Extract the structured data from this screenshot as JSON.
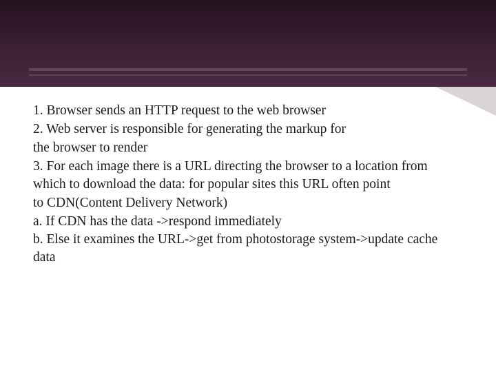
{
  "slide": {
    "lines": [
      "1. Browser sends an HTTP request to the web browser",
      "2. Web server is responsible for generating the markup for",
      "the browser to render",
      "3. For each image there is a URL directing the  browser to a location from which to download the data: for popular sites this URL often point",
      "to CDN(Content Delivery Network)",
      "a. If CDN has the data ->respond immediately",
      "b. Else it examines the URL->get from  photostorage system->update cache data"
    ]
  }
}
